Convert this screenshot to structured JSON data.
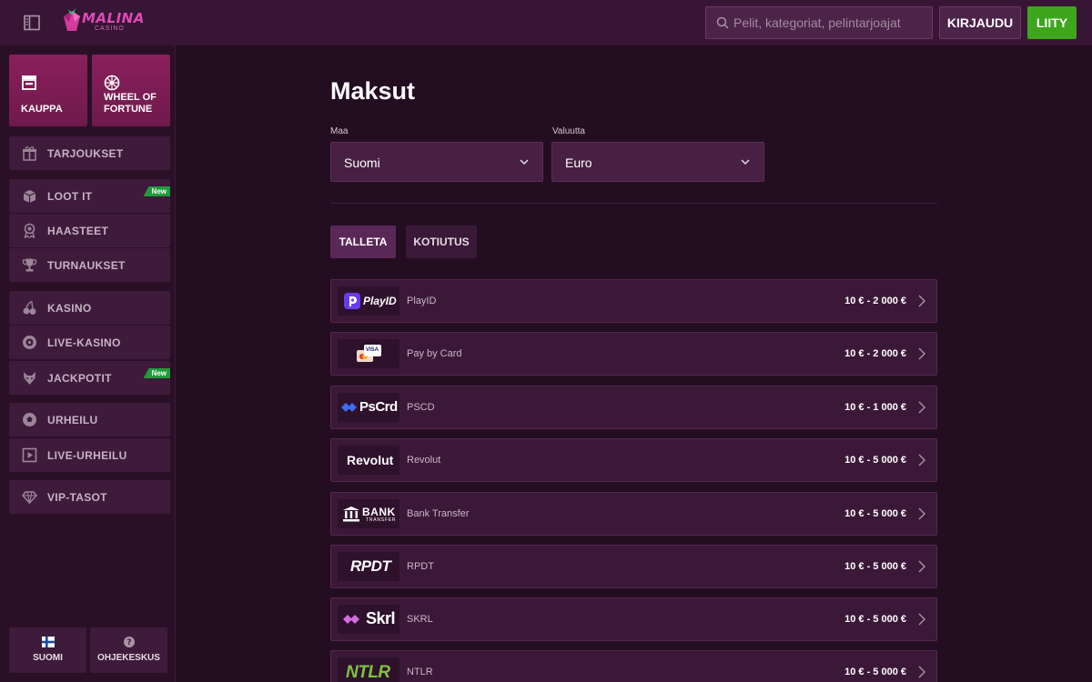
{
  "header": {
    "brand": "MALINA",
    "brand_sub": "CASINO",
    "search_placeholder": "Pelit, kategoriat, pelintarjoajat",
    "login_label": "KIRJAUDU",
    "join_label": "LIITY"
  },
  "sidebar": {
    "tiles": [
      {
        "label": "KAUPPA",
        "icon": "shop-icon"
      },
      {
        "label": "WHEEL OF FORTUNE",
        "icon": "wheel-icon"
      }
    ],
    "items": [
      {
        "label": "TARJOUKSET",
        "icon": "gift-icon"
      },
      {
        "label": "LOOT IT",
        "icon": "loot-box-icon",
        "badge": "New"
      },
      {
        "label": "HAASTEET",
        "icon": "ribbon-icon"
      },
      {
        "label": "TURNAUKSET",
        "icon": "trophy-icon"
      },
      {
        "label": "KASINO",
        "icon": "cherries-icon"
      },
      {
        "label": "LIVE-KASINO",
        "icon": "roulette-icon"
      },
      {
        "label": "JACKPOTIT",
        "icon": "wolf-icon",
        "badge": "New"
      },
      {
        "label": "URHEILU",
        "icon": "football-icon"
      },
      {
        "label": "LIVE-URHEILU",
        "icon": "live-play-icon"
      },
      {
        "label": "VIP-TASOT",
        "icon": "diamond-icon"
      }
    ],
    "footer": {
      "language_label": "SUOMI",
      "help_label": "OHJEKESKUS"
    }
  },
  "main": {
    "title": "Maksut",
    "country": {
      "label": "Maa",
      "value": "Suomi"
    },
    "currency": {
      "label": "Valuutta",
      "value": "Euro"
    },
    "tabs": [
      {
        "label": "TALLETA",
        "active": true
      },
      {
        "label": "KOTIUTUS",
        "active": false
      }
    ],
    "methods": [
      {
        "logo_text": "PlayID",
        "name": "PlayID",
        "range": "10 € - 2 000 €"
      },
      {
        "logo_text": "VISA",
        "name": "Pay by Card",
        "range": "10 € - 2 000 €"
      },
      {
        "logo_text": "PsCrd",
        "name": "PSCD",
        "range": "10 € - 1 000 €"
      },
      {
        "logo_text": "Revolut",
        "name": "Revolut",
        "range": "10 € - 5 000 €"
      },
      {
        "logo_text": "BANK",
        "logo_sub": "TRANSFER",
        "name": "Bank Transfer",
        "range": "10 € - 5 000 €"
      },
      {
        "logo_text": "RPDT",
        "name": "RPDT",
        "range": "10 € - 5 000 €"
      },
      {
        "logo_text": "Skrl",
        "name": "SKRL",
        "range": "10 € - 5 000 €"
      },
      {
        "logo_text": "NTLR",
        "name": "NTLR",
        "range": "10 € - 5 000 €"
      }
    ]
  },
  "colors": {
    "accent_green": "#3da61c",
    "tile_magenta": "#8a1f5c",
    "badge_green": "#1f9c3a"
  }
}
